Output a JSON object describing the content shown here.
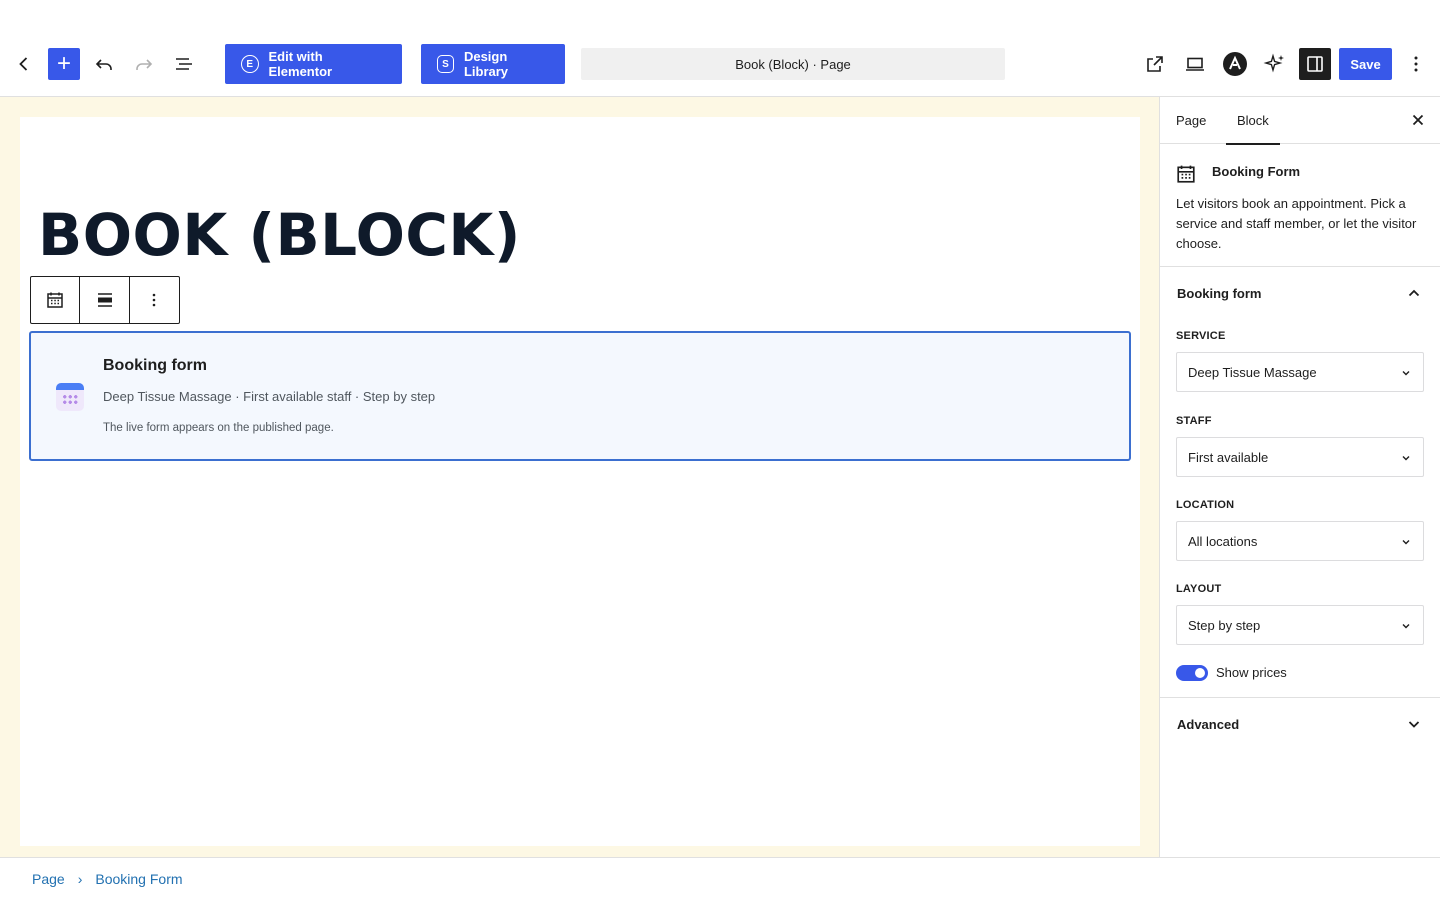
{
  "toolbar": {
    "elementor_label": "Edit with Elementor",
    "design_library_label": "Design Library",
    "document_title": "Book (Block) · Page",
    "save_label": "Save",
    "add_symbol": "+",
    "elementor_badge": "E",
    "design_library_badge": "S"
  },
  "canvas": {
    "page_title": "BOOK (BLOCK)",
    "block": {
      "title": "Booking form",
      "meta": "Deep Tissue Massage · First available staff · Step by step",
      "note": "The live form appears on the published page."
    }
  },
  "breadcrumb": {
    "items": [
      "Page",
      "Booking Form"
    ],
    "separator": "›"
  },
  "sidebar": {
    "tabs": [
      "Page",
      "Block"
    ],
    "active_tab": "Block",
    "block_card": {
      "title": "Booking Form",
      "description": "Let visitors book an appointment. Pick a service and staff member, or let the visitor choose."
    },
    "panel": {
      "title": "Booking form",
      "fields": {
        "service": {
          "label": "Service",
          "value": "Deep Tissue Massage"
        },
        "staff": {
          "label": "Staff",
          "value": "First available"
        },
        "location": {
          "label": "Location",
          "value": "All locations"
        },
        "layout": {
          "label": "Layout",
          "value": "Step by step"
        }
      },
      "show_prices": {
        "label": "Show prices",
        "checked": true
      }
    },
    "advanced": {
      "title": "Advanced"
    }
  },
  "colors": {
    "accent": "#3858e9",
    "canvas_background": "#fdf8e4",
    "selection_border": "#3b6fd0",
    "link": "#2271b1"
  }
}
